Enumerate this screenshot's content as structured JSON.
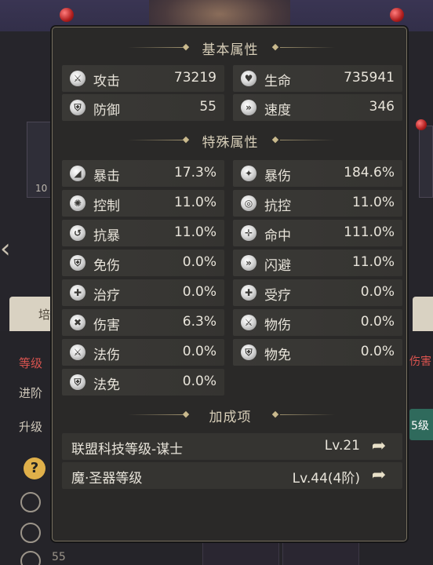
{
  "background": {
    "left_card_number": "10",
    "left_tab_label": "培",
    "left_rows": [
      {
        "label": "等级",
        "style": "red"
      },
      {
        "label": "进阶",
        "style": "normal"
      },
      {
        "label": "升级",
        "style": "normal"
      }
    ],
    "right_text": "伤害",
    "right_button_label": "5级",
    "help_icon": "?",
    "bottom_number": "55"
  },
  "popup": {
    "basic_section": {
      "title": "基本属性",
      "stats": [
        {
          "name": "攻击",
          "value": "73219",
          "icon": "attack-icon"
        },
        {
          "name": "生命",
          "value": "735941",
          "icon": "heart-icon"
        },
        {
          "name": "防御",
          "value": "55",
          "icon": "shield-icon"
        },
        {
          "name": "速度",
          "value": "346",
          "icon": "boot-icon"
        }
      ]
    },
    "special_section": {
      "title": "特殊属性",
      "stats": [
        {
          "name": "暴击",
          "value": "17.3%",
          "icon": "crit-icon"
        },
        {
          "name": "暴伤",
          "value": "184.6%",
          "icon": "crit-damage-icon"
        },
        {
          "name": "控制",
          "value": "11.0%",
          "icon": "control-icon"
        },
        {
          "name": "抗控",
          "value": "11.0%",
          "icon": "anti-control-icon"
        },
        {
          "name": "抗暴",
          "value": "11.0%",
          "icon": "anti-crit-icon"
        },
        {
          "name": "命中",
          "value": "111.0%",
          "icon": "target-icon"
        },
        {
          "name": "免伤",
          "value": "0.0%",
          "icon": "damage-reduction-icon"
        },
        {
          "name": "闪避",
          "value": "11.0%",
          "icon": "dodge-icon"
        },
        {
          "name": "治疗",
          "value": "0.0%",
          "icon": "heal-icon"
        },
        {
          "name": "受疗",
          "value": "0.0%",
          "icon": "received-heal-icon"
        },
        {
          "name": "伤害",
          "value": "6.3%",
          "icon": "damage-icon"
        },
        {
          "name": "物伤",
          "value": "0.0%",
          "icon": "physical-damage-icon"
        },
        {
          "name": "法伤",
          "value": "0.0%",
          "icon": "magic-damage-icon"
        },
        {
          "name": "物免",
          "value": "0.0%",
          "icon": "physical-immunity-icon"
        },
        {
          "name": "法免",
          "value": "0.0%",
          "icon": "magic-immunity-icon"
        }
      ]
    },
    "bonus_section": {
      "title": "加成项",
      "items": [
        {
          "name": "联盟科技等级-谋士",
          "value": "Lv.21",
          "icon": "go-arrow-icon"
        },
        {
          "name": "魔·圣器等级",
          "value": "Lv.44(4阶)",
          "icon": "go-arrow-icon"
        }
      ]
    }
  }
}
